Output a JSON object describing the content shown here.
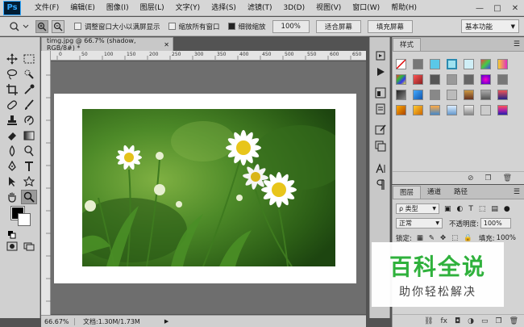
{
  "app": {
    "logo": "Ps"
  },
  "menu": [
    "文件(F)",
    "编辑(E)",
    "图像(I)",
    "图层(L)",
    "文字(Y)",
    "选择(S)",
    "滤镜(T)",
    "3D(D)",
    "视图(V)",
    "窗口(W)",
    "帮助(H)"
  ],
  "window_controls": {
    "minimize": "—",
    "maximize": "□",
    "close": "✕"
  },
  "options": {
    "resize_windows_label": "调整窗口大小以满屏显示",
    "zoom_all_label": "缩放所有窗口",
    "scrubby_zoom_label": "细微缩放",
    "zoom_100_label": "100%",
    "fit_screen_label": "适合屏幕",
    "fill_screen_label": "填充屏幕",
    "workspace": "基本功能"
  },
  "document": {
    "tab_title": "timg.jpg @ 66.7% (shadow, RGB/8#) *",
    "zoom": "66.67%",
    "doc_info": "文档:1.30M/1.73M"
  },
  "ruler_numbers": [
    "0",
    "50",
    "100",
    "150",
    "200",
    "250",
    "300",
    "350",
    "400",
    "450",
    "500",
    "550",
    "600",
    "650"
  ],
  "styles_panel": {
    "tab": "样式"
  },
  "layers_panel": {
    "tabs": [
      "图层",
      "通道",
      "路径"
    ],
    "filter_kind": "ρ 类型",
    "blend_mode": "正常",
    "opacity_label": "不透明度:",
    "opacity_value": "100%",
    "lock_label": "锁定:",
    "fill_label": "填充:",
    "fill_value": "100%"
  },
  "watermark": {
    "title": "百科全说",
    "subtitle": "助你轻松解决"
  },
  "colors": {
    "foreground": "#000000",
    "background": "#ffffff",
    "watermark_green": "#2fb13c"
  }
}
